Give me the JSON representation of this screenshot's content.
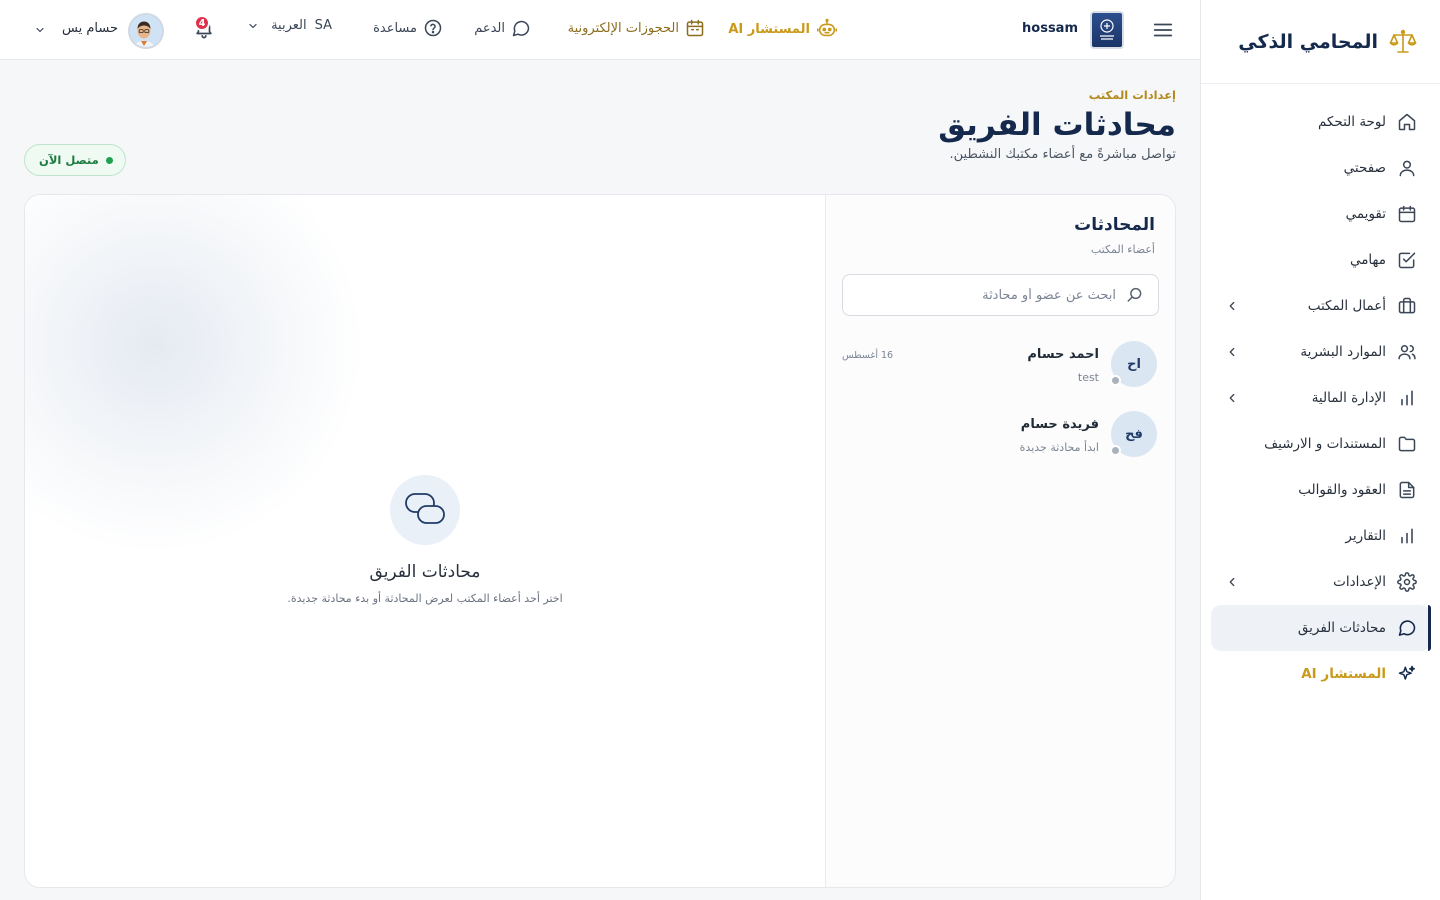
{
  "brand": {
    "name": "المحامي الذكي"
  },
  "sidebar": {
    "items": [
      {
        "label": "لوحة التحكم",
        "icon": "home-icon"
      },
      {
        "label": "صفحتي",
        "icon": "user-icon"
      },
      {
        "label": "تقويمي",
        "icon": "calendar-icon"
      },
      {
        "label": "مهامي",
        "icon": "check-square-icon"
      },
      {
        "label": "أعمال المكتب",
        "icon": "briefcase-icon"
      },
      {
        "label": "الموارد البشرية",
        "icon": "users-icon"
      },
      {
        "label": "الإدارة المالية",
        "icon": "bar-chart-icon"
      },
      {
        "label": "المستندات و الارشيف",
        "icon": "folder-icon"
      },
      {
        "label": "العقود والقوالب",
        "icon": "file-text-icon"
      },
      {
        "label": "التقارير",
        "icon": "bar-chart-icon"
      },
      {
        "label": "الإعدادات",
        "icon": "gear-icon"
      },
      {
        "label": "محادثات الفريق",
        "icon": "message-circle-icon"
      },
      {
        "label": "المستشار AI",
        "icon": "sparkles-icon"
      }
    ]
  },
  "topbar": {
    "office_name": "hossam",
    "nav": {
      "ai": "المستشار AI",
      "bookings": "الحجوزات الإلكترونية",
      "support": "الدعم",
      "help": "مساعدة"
    },
    "language": {
      "label": "العربية",
      "code": "SA"
    },
    "notifications_count": "4",
    "profile_name": "حسام يس"
  },
  "page": {
    "breadcrumb": "إعدادات المكتب",
    "title": "محادثات الفريق",
    "subtitle": "تواصل مباشرةً مع أعضاء مكتبك النشطين.",
    "status": "متصل الآن"
  },
  "conversations": {
    "title": "المحادثات",
    "subtitle": "أعضاء المكتب",
    "search_placeholder": "ابحث عن عضو أو محادثة",
    "items": [
      {
        "initials": "اح",
        "name": "احمد حسام",
        "last_message": "test",
        "date": "16 أغسطس"
      },
      {
        "initials": "فح",
        "name": "فريدة حسام",
        "last_message": "ابدأ محادثة جديدة",
        "date": ""
      }
    ]
  },
  "empty_state": {
    "title": "محادثات الفريق",
    "subtitle": "اختر أحد أعضاء المكتب لعرض المحادثة أو بدء محادثة جديدة."
  },
  "colors": {
    "primary": "#14294b",
    "accent_gold": "#c99a1a",
    "online_green": "#20a150",
    "badge_red": "#e0314b"
  }
}
